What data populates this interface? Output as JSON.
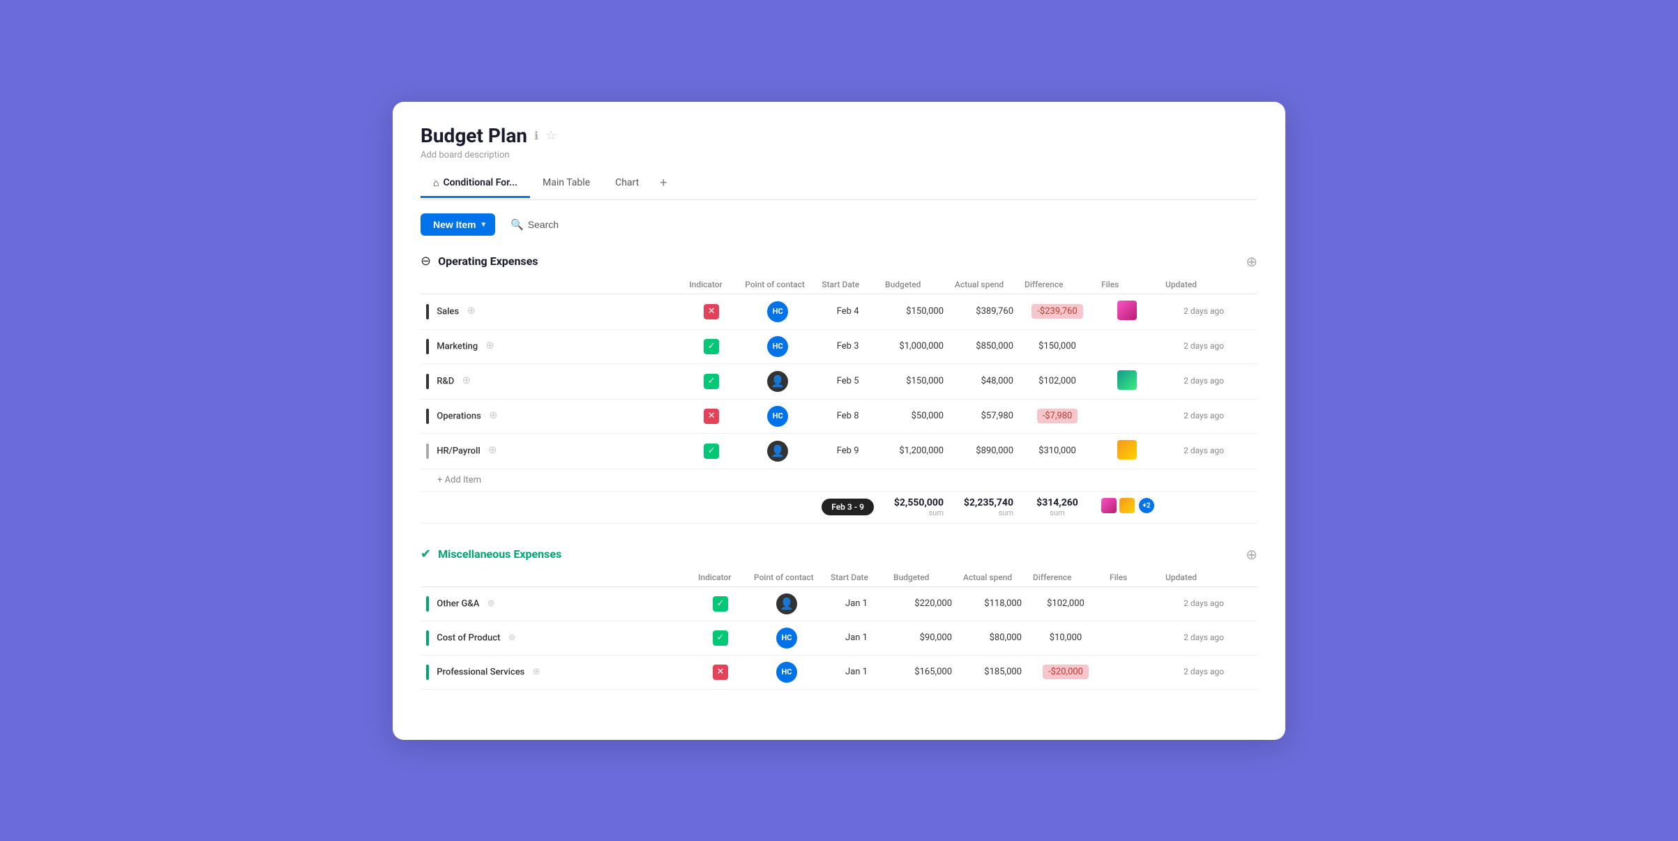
{
  "board": {
    "title": "Budget Plan",
    "description": "Add board description"
  },
  "tabs": [
    {
      "label": "Conditional For...",
      "active": true,
      "icon": "home"
    },
    {
      "label": "Main Table",
      "active": false
    },
    {
      "label": "Chart",
      "active": false
    },
    {
      "label": "+",
      "add": true
    }
  ],
  "toolbar": {
    "new_item_label": "New Item",
    "search_label": "Search"
  },
  "sections": [
    {
      "id": "operating",
      "title": "Operating Expenses",
      "color": "dark",
      "columns": [
        "Indicator",
        "Point of contact",
        "Start Date",
        "Budgeted",
        "Actual spend",
        "Difference",
        "Files",
        "Updated"
      ],
      "rows": [
        {
          "name": "Sales",
          "indicator": "red",
          "contact_initials": "HC",
          "contact_type": "blue",
          "start_date": "Feb 4",
          "budgeted": "$150,000",
          "actual": "$389,760",
          "difference": "-$239,760",
          "diff_type": "negative",
          "files": "thumb1",
          "updated": "2 days ago"
        },
        {
          "name": "Marketing",
          "indicator": "green",
          "contact_initials": "HC",
          "contact_type": "blue",
          "start_date": "Feb 3",
          "budgeted": "$1,000,000",
          "actual": "$850,000",
          "difference": "$150,000",
          "diff_type": "positive",
          "files": "none",
          "updated": "2 days ago"
        },
        {
          "name": "R&D",
          "indicator": "green",
          "contact_initials": "",
          "contact_type": "dark",
          "start_date": "Feb 5",
          "budgeted": "$150,000",
          "actual": "$48,000",
          "difference": "$102,000",
          "diff_type": "positive",
          "files": "thumb2",
          "updated": "2 days ago"
        },
        {
          "name": "Operations",
          "indicator": "red",
          "contact_initials": "HC",
          "contact_type": "blue",
          "start_date": "Feb 8",
          "budgeted": "$50,000",
          "actual": "$57,980",
          "difference": "-$7,980",
          "diff_type": "negative",
          "files": "none",
          "updated": "2 days ago"
        },
        {
          "name": "HR/Payroll",
          "indicator": "green",
          "contact_initials": "",
          "contact_type": "dark",
          "start_date": "Feb 9",
          "budgeted": "$1,200,000",
          "actual": "$890,000",
          "difference": "$310,000",
          "diff_type": "positive",
          "files": "thumb3",
          "updated": "2 days ago"
        }
      ],
      "summary": {
        "date_range": "Feb 3 - 9",
        "budgeted": "$2,550,000",
        "actual": "$2,235,740",
        "difference": "$314,260",
        "files_count": "+2"
      }
    },
    {
      "id": "misc",
      "title": "Miscellaneous Expenses",
      "color": "green",
      "columns": [
        "Indicator",
        "Point of contact",
        "Start Date",
        "Budgeted",
        "Actual spend",
        "Difference",
        "Files",
        "Updated"
      ],
      "rows": [
        {
          "name": "Other G&A",
          "indicator": "green",
          "contact_initials": "",
          "contact_type": "dark",
          "start_date": "Jan 1",
          "budgeted": "$220,000",
          "actual": "$118,000",
          "difference": "$102,000",
          "diff_type": "positive",
          "files": "none",
          "updated": "2 days ago"
        },
        {
          "name": "Cost of Product",
          "indicator": "green",
          "contact_initials": "HC",
          "contact_type": "blue",
          "start_date": "Jan 1",
          "budgeted": "$90,000",
          "actual": "$80,000",
          "difference": "$10,000",
          "diff_type": "positive",
          "files": "none",
          "updated": "2 days ago"
        },
        {
          "name": "Professional Services",
          "indicator": "red",
          "contact_initials": "HC",
          "contact_type": "blue",
          "start_date": "Jan 1",
          "budgeted": "$165,000",
          "actual": "$185,000",
          "difference": "-$20,000",
          "diff_type": "negative",
          "files": "none",
          "updated": "2 days ago"
        }
      ]
    }
  ],
  "status": {
    "updated_label": "Updated"
  }
}
